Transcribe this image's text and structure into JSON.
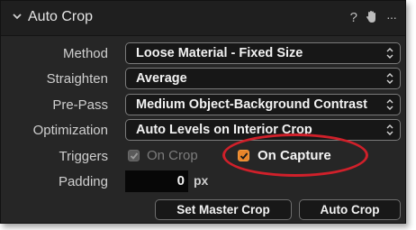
{
  "panel": {
    "title": "Auto Crop",
    "header_icons": [
      "question-icon",
      "hand-icon",
      "more-icon"
    ],
    "help_glyph": "?",
    "more_glyph": "···"
  },
  "fields": {
    "method": {
      "label": "Method",
      "value": "Loose Material - Fixed Size"
    },
    "straighten": {
      "label": "Straighten",
      "value": "Average"
    },
    "prepass": {
      "label": "Pre-Pass",
      "value": "Medium Object-Background Contrast"
    },
    "optimization": {
      "label": "Optimization",
      "value": "Auto Levels on Interior Crop"
    }
  },
  "triggers": {
    "label": "Triggers",
    "on_crop": {
      "label": "On Crop",
      "checked": true,
      "enabled": false
    },
    "on_capture": {
      "label": "On Capture",
      "checked": true,
      "enabled": true
    }
  },
  "padding": {
    "label": "Padding",
    "value": "0",
    "unit": "px"
  },
  "buttons": {
    "set_master_crop": "Set Master Crop",
    "auto_crop": "Auto Crop"
  },
  "colors": {
    "accent": "#e8852a",
    "highlight_ring": "#d0202a",
    "panel_bg": "#262626"
  }
}
